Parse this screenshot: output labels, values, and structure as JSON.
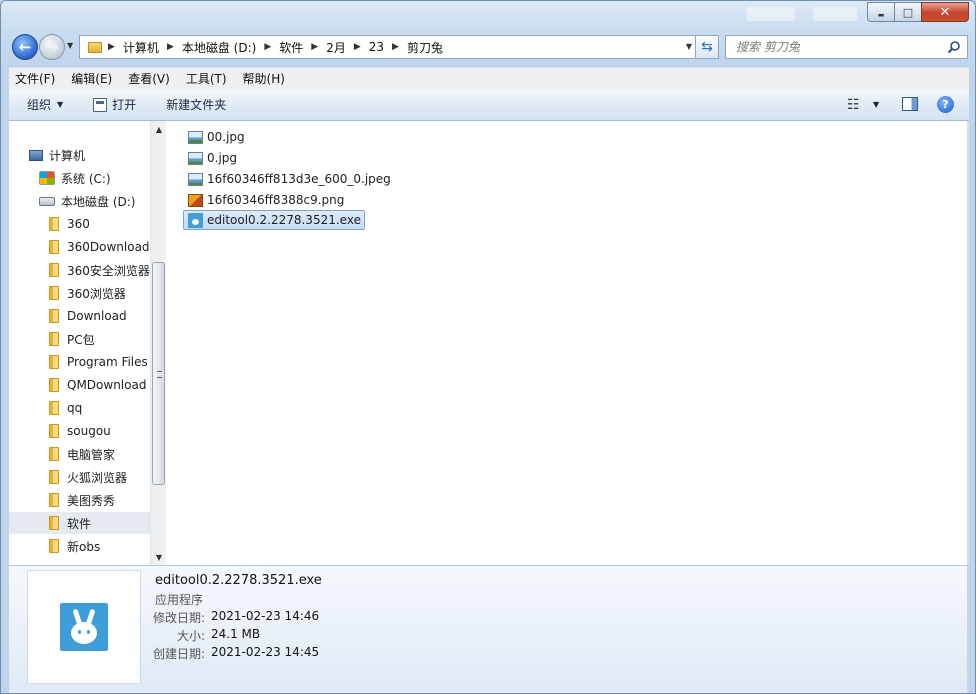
{
  "window": {
    "controls": {
      "minimize": "▬",
      "maximize": "□",
      "close": "✕"
    }
  },
  "nav": {
    "back_glyph": "←",
    "forward_glyph": "→"
  },
  "address": {
    "crumbs": [
      "计算机",
      "本地磁盘 (D:)",
      "软件",
      "2月",
      "23",
      "剪刀兔"
    ]
  },
  "search": {
    "placeholder": "搜索 剪刀兔"
  },
  "menu": {
    "items": [
      "文件(F)",
      "编辑(E)",
      "查看(V)",
      "工具(T)",
      "帮助(H)"
    ]
  },
  "toolbar": {
    "organize": "组织",
    "open": "打开",
    "new_folder": "新建文件夹"
  },
  "tree": {
    "computer": "计算机",
    "drive_c": "系统 (C:)",
    "drive_d": "本地磁盘 (D:)",
    "folders": [
      "360",
      "360Download",
      "360安全浏览器",
      "360浏览器",
      "Download",
      "PC包",
      "Program Files",
      "QMDownload",
      "qq",
      "sougou",
      "电脑管家",
      "火狐浏览器",
      "美图秀秀",
      "软件",
      "新obs"
    ],
    "selected": "软件"
  },
  "files": [
    {
      "name": "00.jpg",
      "type": "image"
    },
    {
      "name": "0.jpg",
      "type": "image"
    },
    {
      "name": "16f60346ff813d3e_600_0.jpeg",
      "type": "image"
    },
    {
      "name": "16f60346ff8388c9.png",
      "type": "png"
    },
    {
      "name": "editool0.2.2278.3521.exe",
      "type": "exe",
      "selected": true
    }
  ],
  "details": {
    "name": "editool0.2.2278.3521.exe",
    "type": "应用程序",
    "modified_label": "修改日期:",
    "modified": "2021-02-23 14:46",
    "size_label": "大小:",
    "size": "24.1 MB",
    "created_label": "创建日期:",
    "created": "2021-02-23 14:45"
  },
  "colors": {
    "selection": "#cfe3f8",
    "selection_border": "#7da2ce",
    "close_button": "#c5442c",
    "app_icon": "#3e9fd8"
  }
}
